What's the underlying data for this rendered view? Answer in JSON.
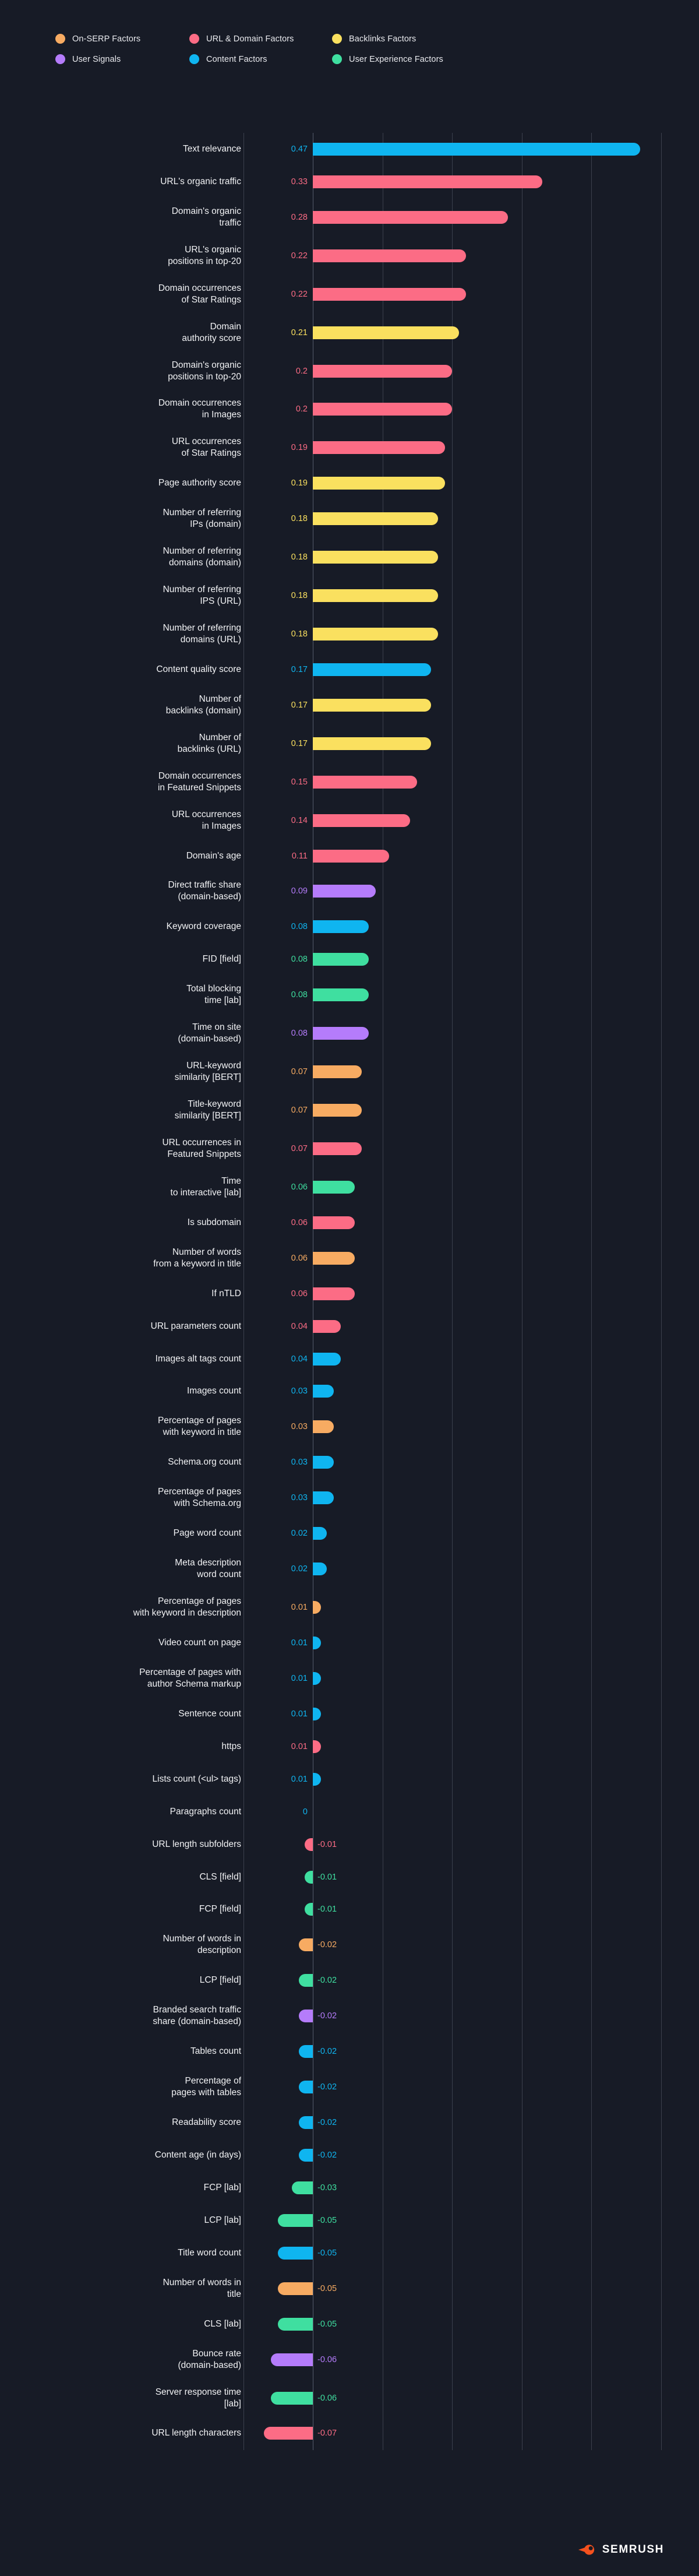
{
  "legend": {
    "items": [
      {
        "label": "On-SERP Factors",
        "color": "#f7ab62"
      },
      {
        "label": "URL & Domain Factors",
        "color": "#fc6c85"
      },
      {
        "label": "Backlinks Factors",
        "color": "#fae05f"
      },
      {
        "label": "User Signals",
        "color": "#b57cfb"
      },
      {
        "label": "Content Factors",
        "color": "#0fb5f0"
      },
      {
        "label": "User Experience Factors",
        "color": "#3fdfa0"
      }
    ]
  },
  "footer": {
    "brand": "SEMRUSH",
    "logo_color": "#f4511e"
  },
  "chart_data": {
    "type": "bar",
    "orientation": "horizontal",
    "title": "",
    "xlabel": "",
    "ylabel": "",
    "xlim": [
      -0.1,
      0.6
    ],
    "grid": true,
    "gridlines": [
      -0.1,
      0,
      0.1,
      0.2,
      0.3,
      0.4,
      0.5
    ],
    "legend_position": "top-left",
    "series_colors": {
      "On-SERP Factors": "#f7ab62",
      "URL & Domain Factors": "#fc6c85",
      "Backlinks Factors": "#fae05f",
      "User Signals": "#b57cfb",
      "Content Factors": "#0fb5f0",
      "User Experience Factors": "#3fdfa0"
    },
    "points": [
      {
        "label": "Text relevance",
        "value": 0.47,
        "display": "0.47",
        "group": "Content Factors"
      },
      {
        "label": "URL's organic traffic",
        "value": 0.33,
        "display": "0.33",
        "group": "URL & Domain Factors"
      },
      {
        "label": "Domain's organic\ntraffic",
        "value": 0.28,
        "display": "0.28",
        "group": "URL & Domain Factors"
      },
      {
        "label": "URL's organic\npositions in top-20",
        "value": 0.22,
        "display": "0.22",
        "group": "URL & Domain Factors"
      },
      {
        "label": "Domain occurrences\nof Star Ratings",
        "value": 0.22,
        "display": "0.22",
        "group": "URL & Domain Factors"
      },
      {
        "label": "Domain\nauthority score",
        "value": 0.21,
        "display": "0.21",
        "group": "Backlinks Factors"
      },
      {
        "label": "Domain's organic\npositions in top-20",
        "value": 0.2,
        "display": "0.2",
        "group": "URL & Domain Factors"
      },
      {
        "label": "Domain occurrences\nin Images",
        "value": 0.2,
        "display": "0.2",
        "group": "URL & Domain Factors"
      },
      {
        "label": "URL occurrences\nof Star Ratings",
        "value": 0.19,
        "display": "0.19",
        "group": "URL & Domain Factors"
      },
      {
        "label": "Page authority score",
        "value": 0.19,
        "display": "0.19",
        "group": "Backlinks Factors"
      },
      {
        "label": "Number of referring\nIPs (domain)",
        "value": 0.18,
        "display": "0.18",
        "group": "Backlinks Factors"
      },
      {
        "label": "Number of referring\ndomains (domain)",
        "value": 0.18,
        "display": "0.18",
        "group": "Backlinks Factors"
      },
      {
        "label": "Number of referring\nIPS (URL)",
        "value": 0.18,
        "display": "0.18",
        "group": "Backlinks Factors"
      },
      {
        "label": "Number of referring\ndomains (URL)",
        "value": 0.18,
        "display": "0.18",
        "group": "Backlinks Factors"
      },
      {
        "label": "Content quality score",
        "value": 0.17,
        "display": "0.17",
        "group": "Content Factors"
      },
      {
        "label": "Number of\nbacklinks (domain)",
        "value": 0.17,
        "display": "0.17",
        "group": "Backlinks Factors"
      },
      {
        "label": "Number of\nbacklinks (URL)",
        "value": 0.17,
        "display": "0.17",
        "group": "Backlinks Factors"
      },
      {
        "label": "Domain occurrences\nin Featured Snippets",
        "value": 0.15,
        "display": "0.15",
        "group": "URL & Domain Factors"
      },
      {
        "label": "URL occurrences\nin Images",
        "value": 0.14,
        "display": "0.14",
        "group": "URL & Domain Factors"
      },
      {
        "label": "Domain's age",
        "value": 0.11,
        "display": "0.11",
        "group": "URL & Domain Factors"
      },
      {
        "label": "Direct traffic share\n(domain-based)",
        "value": 0.09,
        "display": "0.09",
        "group": "User Signals"
      },
      {
        "label": "Keyword coverage",
        "value": 0.08,
        "display": "0.08",
        "group": "Content Factors"
      },
      {
        "label": "FID [field]",
        "value": 0.08,
        "display": "0.08",
        "group": "User Experience Factors"
      },
      {
        "label": "Total blocking\ntime [lab]",
        "value": 0.08,
        "display": "0.08",
        "group": "User Experience Factors"
      },
      {
        "label": "Time on site\n(domain-based)",
        "value": 0.08,
        "display": "0.08",
        "group": "User Signals"
      },
      {
        "label": "URL-keyword\nsimilarity [BERT]",
        "value": 0.07,
        "display": "0.07",
        "group": "On-SERP Factors"
      },
      {
        "label": "Title-keyword\nsimilarity [BERT]",
        "value": 0.07,
        "display": "0.07",
        "group": "On-SERP Factors"
      },
      {
        "label": "URL occurrences in\nFeatured Snippets",
        "value": 0.07,
        "display": "0.07",
        "group": "URL & Domain Factors"
      },
      {
        "label": "Time\nto interactive [lab]",
        "value": 0.06,
        "display": "0.06",
        "group": "User Experience Factors"
      },
      {
        "label": "Is subdomain",
        "value": 0.06,
        "display": "0.06",
        "group": "URL & Domain Factors"
      },
      {
        "label": "Number of words\nfrom a keyword in title",
        "value": 0.06,
        "display": "0.06",
        "group": "On-SERP Factors"
      },
      {
        "label": "If nTLD",
        "value": 0.06,
        "display": "0.06",
        "group": "URL & Domain Factors"
      },
      {
        "label": "URL parameters count",
        "value": 0.04,
        "display": "0.04",
        "group": "URL & Domain Factors"
      },
      {
        "label": "Images alt tags count",
        "value": 0.04,
        "display": "0.04",
        "group": "Content Factors"
      },
      {
        "label": "Images count",
        "value": 0.03,
        "display": "0.03",
        "group": "Content Factors"
      },
      {
        "label": "Percentage of pages\nwith keyword in title",
        "value": 0.03,
        "display": "0.03",
        "group": "On-SERP Factors"
      },
      {
        "label": "Schema.org count",
        "value": 0.03,
        "display": "0.03",
        "group": "Content Factors"
      },
      {
        "label": "Percentage of pages\nwith Schema.org",
        "value": 0.03,
        "display": "0.03",
        "group": "Content Factors"
      },
      {
        "label": "Page word count",
        "value": 0.02,
        "display": "0.02",
        "group": "Content Factors"
      },
      {
        "label": "Meta description\nword count",
        "value": 0.02,
        "display": "0.02",
        "group": "Content Factors"
      },
      {
        "label": "Percentage of pages\nwith keyword in description",
        "value": 0.01,
        "display": "0.01",
        "group": "On-SERP Factors"
      },
      {
        "label": "Video count on page",
        "value": 0.01,
        "display": "0.01",
        "group": "Content Factors"
      },
      {
        "label": "Percentage of pages with\nauthor Schema markup",
        "value": 0.01,
        "display": "0.01",
        "group": "Content Factors"
      },
      {
        "label": "Sentence count",
        "value": 0.01,
        "display": "0.01",
        "group": "Content Factors"
      },
      {
        "label": "https",
        "value": 0.01,
        "display": "0.01",
        "group": "URL & Domain Factors"
      },
      {
        "label": "Lists count (<ul> tags)",
        "value": 0.01,
        "display": "0.01",
        "group": "Content Factors"
      },
      {
        "label": "Paragraphs count",
        "value": 0,
        "display": "0",
        "group": "Content Factors"
      },
      {
        "label": "URL length subfolders",
        "value": -0.01,
        "display": "-0.01",
        "group": "URL & Domain Factors"
      },
      {
        "label": "CLS [field]",
        "value": -0.01,
        "display": "-0.01",
        "group": "User Experience Factors"
      },
      {
        "label": "FCP [field]",
        "value": -0.01,
        "display": "-0.01",
        "group": "User Experience Factors"
      },
      {
        "label": "Number of words in\ndescription",
        "value": -0.02,
        "display": "-0.02",
        "group": "On-SERP Factors"
      },
      {
        "label": "LCP [field]",
        "value": -0.02,
        "display": "-0.02",
        "group": "User Experience Factors"
      },
      {
        "label": "Branded search traffic\nshare (domain-based)",
        "value": -0.02,
        "display": "-0.02",
        "group": "User Signals"
      },
      {
        "label": "Tables count",
        "value": -0.02,
        "display": "-0.02",
        "group": "Content Factors"
      },
      {
        "label": "Percentage of\npages with tables",
        "value": -0.02,
        "display": "-0.02",
        "group": "Content Factors"
      },
      {
        "label": "Readability score",
        "value": -0.02,
        "display": "-0.02",
        "group": "Content Factors"
      },
      {
        "label": "Content age (in days)",
        "value": -0.02,
        "display": "-0.02",
        "group": "Content Factors"
      },
      {
        "label": "FCP [lab]",
        "value": -0.03,
        "display": "-0.03",
        "group": "User Experience Factors"
      },
      {
        "label": "LCP [lab]",
        "value": -0.05,
        "display": "-0.05",
        "group": "User Experience Factors"
      },
      {
        "label": "Title word count",
        "value": -0.05,
        "display": "-0.05",
        "group": "Content Factors"
      },
      {
        "label": "Number of words in\ntitle",
        "value": -0.05,
        "display": "-0.05",
        "group": "On-SERP Factors"
      },
      {
        "label": "CLS [lab]",
        "value": -0.05,
        "display": "-0.05",
        "group": "User Experience Factors"
      },
      {
        "label": "Bounce rate\n(domain-based)",
        "value": -0.06,
        "display": "-0.06",
        "group": "User Signals"
      },
      {
        "label": "Server response time\n[lab]",
        "value": -0.06,
        "display": "-0.06",
        "group": "User Experience Factors"
      },
      {
        "label": "URL length characters",
        "value": -0.07,
        "display": "-0.07",
        "group": "URL & Domain Factors"
      }
    ]
  }
}
